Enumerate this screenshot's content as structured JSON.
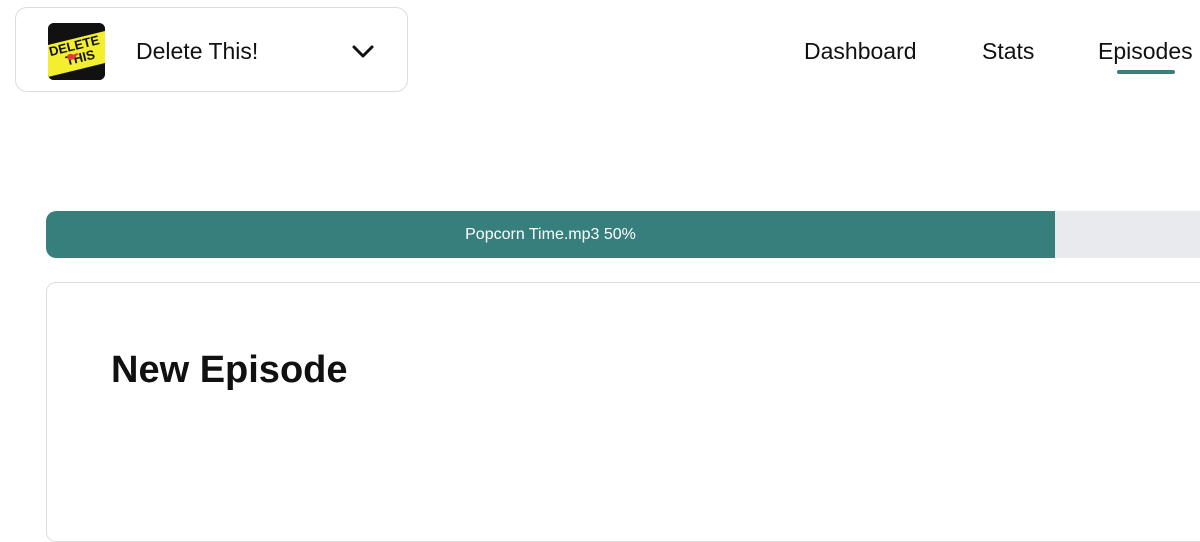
{
  "header": {
    "podcast_selector": {
      "name": "Delete This!",
      "cover_text_line1": "DELETE",
      "cover_text_line2": "THIS",
      "cover_icon": "bird-logo",
      "dropdown_icon": "chevron-down-icon"
    },
    "nav": {
      "items": [
        {
          "label": "Dashboard",
          "active": false
        },
        {
          "label": "Stats",
          "active": false
        },
        {
          "label": "Episodes",
          "active": true
        }
      ]
    }
  },
  "upload": {
    "label": "Popcorn Time.mp3 50%",
    "progress_percent": 50
  },
  "episode_form": {
    "title": "New Episode"
  },
  "colors": {
    "accent": "#367f7d",
    "track": "#e9eaee",
    "cover_yellow": "#f4ef2e"
  }
}
